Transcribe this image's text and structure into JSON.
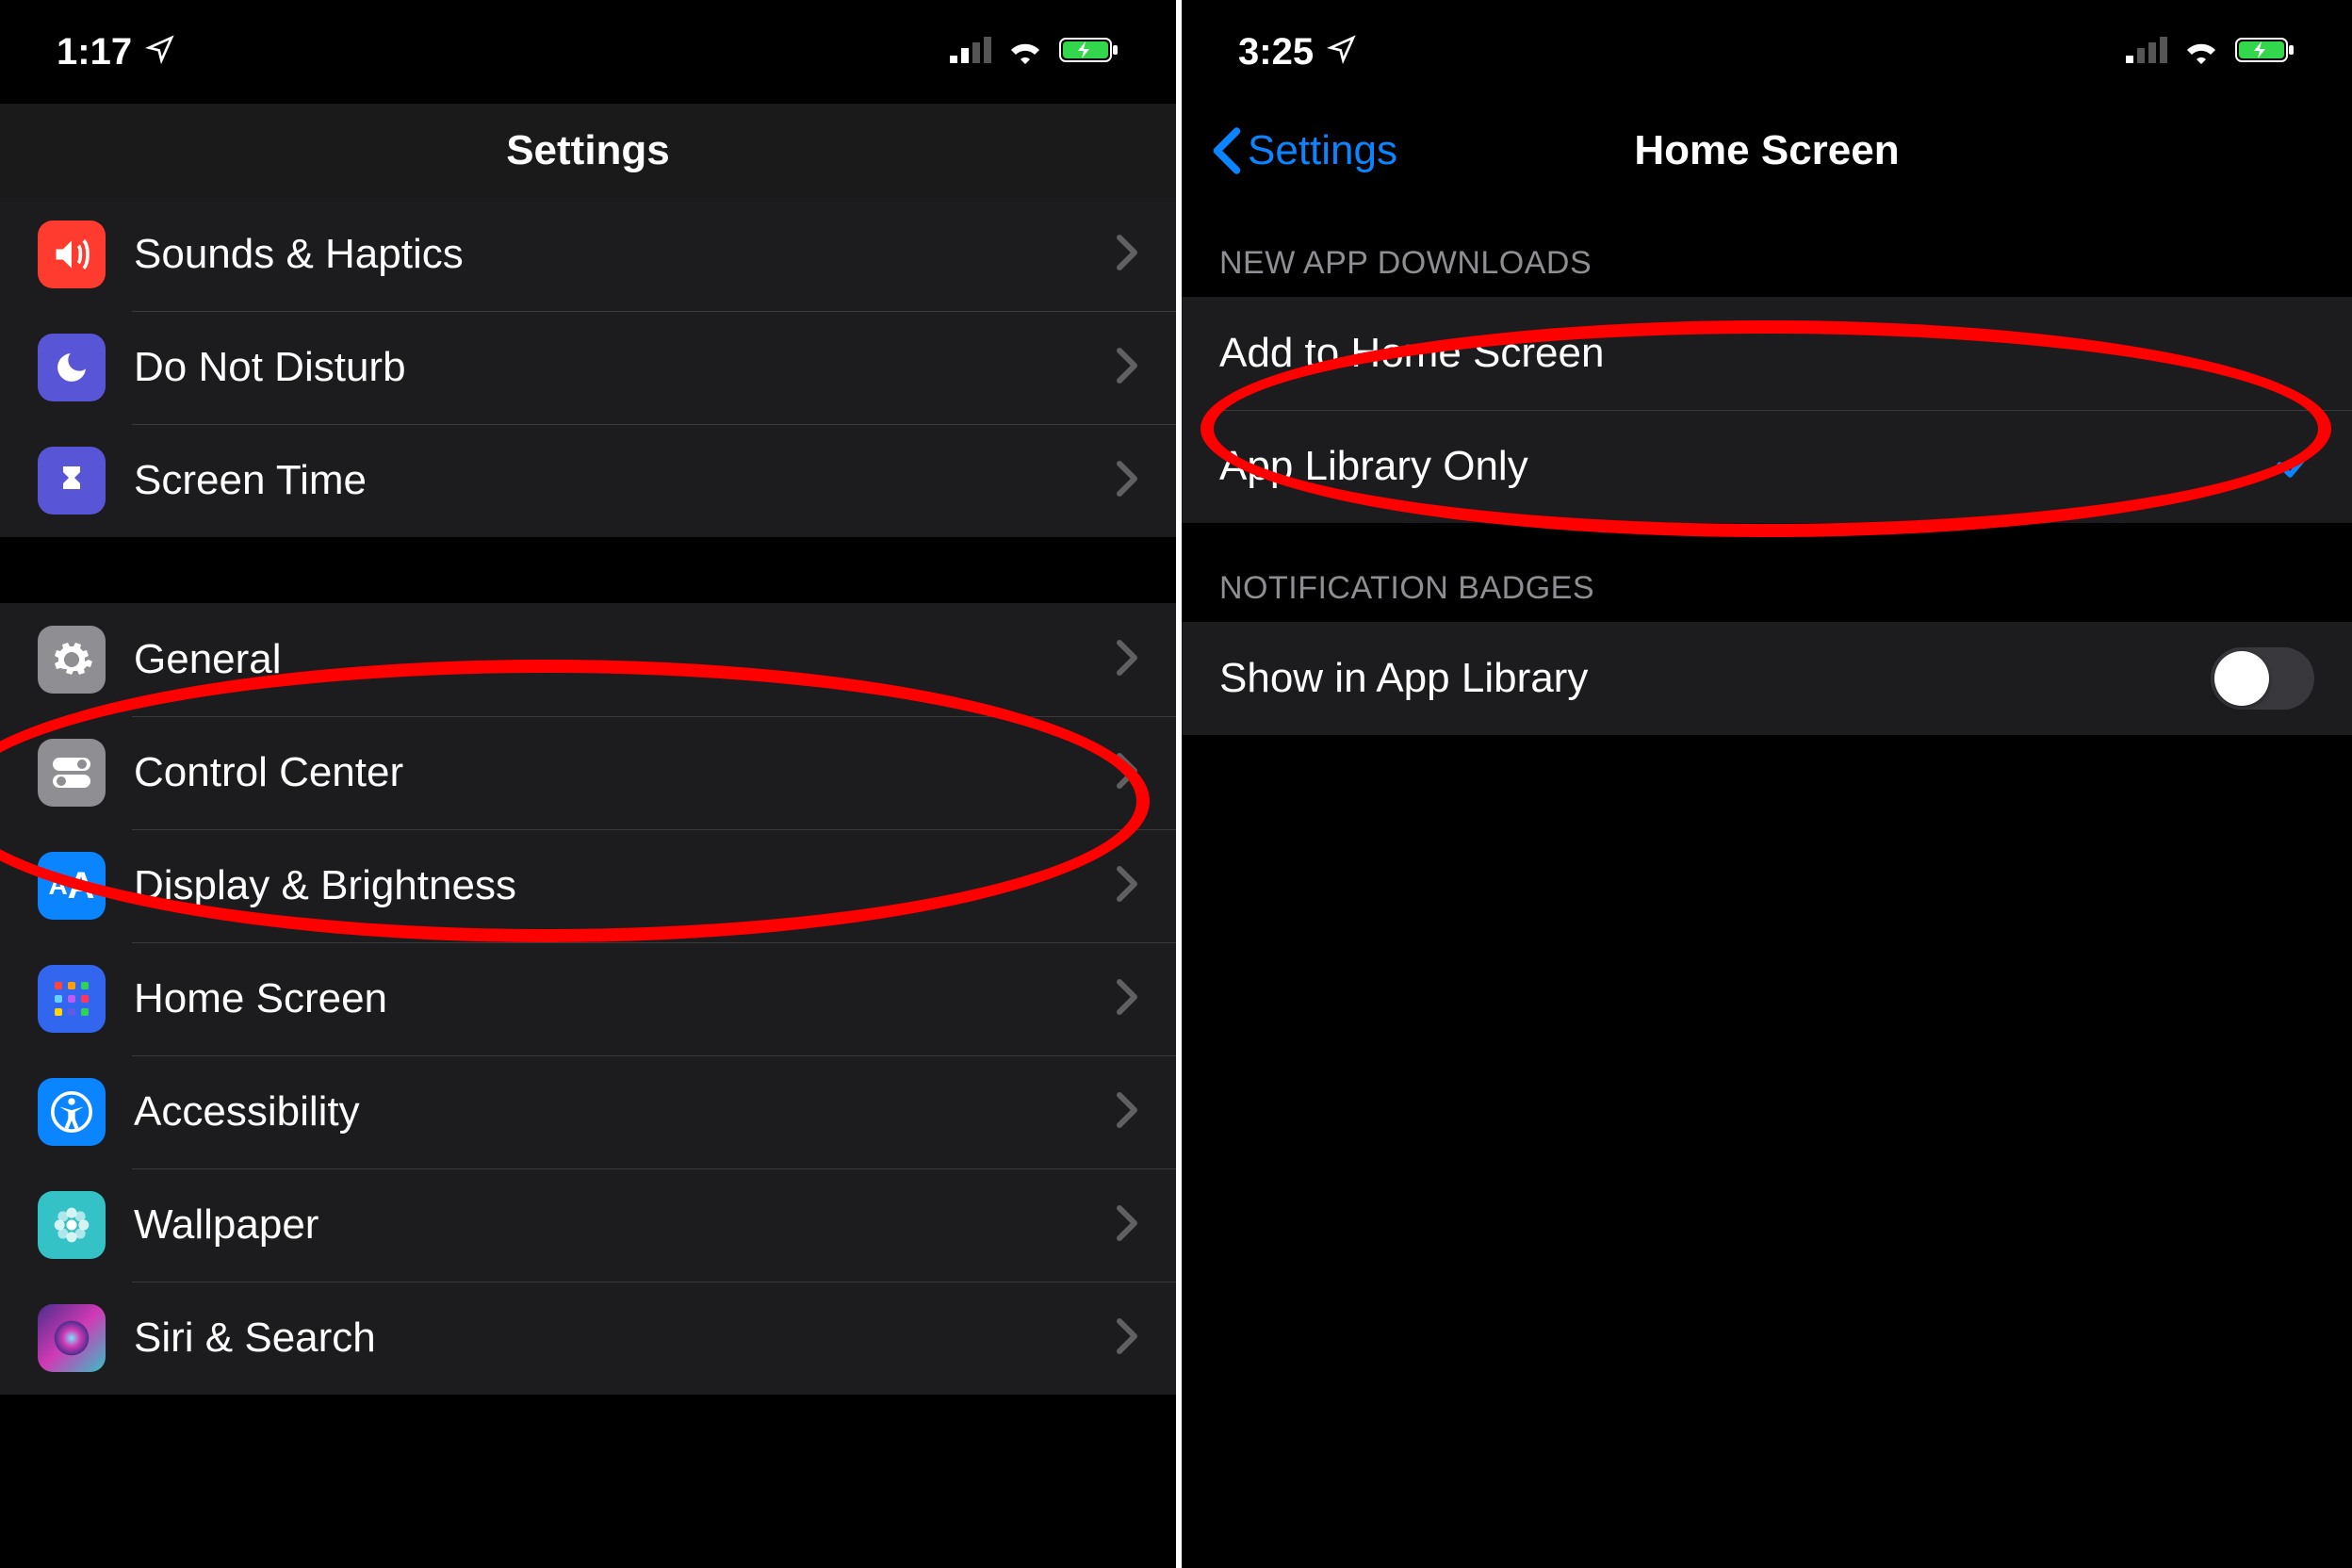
{
  "left": {
    "status": {
      "time": "1:17"
    },
    "nav": {
      "title": "Settings"
    },
    "rows1": [
      {
        "name": "sounds-haptics",
        "label": "Sounds & Haptics",
        "iconClass": "ic-sounds",
        "icon": "sound-icon"
      },
      {
        "name": "do-not-disturb",
        "label": "Do Not Disturb",
        "iconClass": "ic-dnd",
        "icon": "moon-icon"
      },
      {
        "name": "screen-time",
        "label": "Screen Time",
        "iconClass": "ic-screentime",
        "icon": "hourglass-icon"
      }
    ],
    "rows2": [
      {
        "name": "general",
        "label": "General",
        "iconClass": "ic-general",
        "icon": "gear-icon"
      },
      {
        "name": "control-center",
        "label": "Control Center",
        "iconClass": "ic-control",
        "icon": "toggles-icon"
      },
      {
        "name": "display-brightness",
        "label": "Display & Brightness",
        "iconClass": "ic-display",
        "icon": "text-size-icon"
      },
      {
        "name": "home-screen",
        "label": "Home Screen",
        "iconClass": "ic-home",
        "icon": "apps-grid-icon"
      },
      {
        "name": "accessibility",
        "label": "Accessibility",
        "iconClass": "ic-access",
        "icon": "accessibility-icon"
      },
      {
        "name": "wallpaper",
        "label": "Wallpaper",
        "iconClass": "ic-wallpaper",
        "icon": "flower-icon"
      },
      {
        "name": "siri-search",
        "label": "Siri & Search",
        "iconClass": "ic-siri",
        "icon": "siri-icon"
      }
    ]
  },
  "right": {
    "status": {
      "time": "3:25"
    },
    "nav": {
      "back": "Settings",
      "title": "Home Screen"
    },
    "group1": {
      "header": "NEW APP DOWNLOADS",
      "rows": [
        {
          "name": "add-to-home-screen",
          "label": "Add to Home Screen",
          "checked": false
        },
        {
          "name": "app-library-only",
          "label": "App Library Only",
          "checked": true
        }
      ]
    },
    "group2": {
      "header": "NOTIFICATION BADGES",
      "rows": [
        {
          "name": "show-in-app-library",
          "label": "Show in App Library",
          "toggle": false
        }
      ]
    }
  }
}
